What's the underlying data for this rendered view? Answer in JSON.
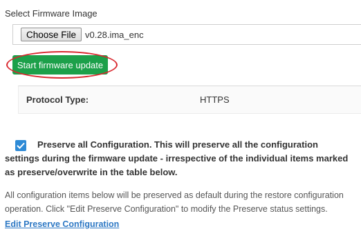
{
  "firmware": {
    "section_label": "Select Firmware Image",
    "choose_file_label": "Choose File",
    "file_name": "v0.28.ima_enc",
    "start_button_label": "Start firmware update"
  },
  "protocol": {
    "label": "Protocol Type:",
    "value": "HTTPS"
  },
  "preserve": {
    "checked": true,
    "text": "Preserve all Configuration. This will preserve all the configuration settings during the firmware update - irrespective of the individual items marked as preserve/overwrite in the table below."
  },
  "info_text": "All configuration items below will be preserved as default during the restore configuration operation. Click \"Edit Preserve Configuration\" to modify the Preserve status settings.",
  "edit_link_label": "Edit Preserve Configuration",
  "colors": {
    "start_button": "#1ca04a",
    "highlight": "#d9272e",
    "checkbox": "#2d8ad6",
    "link": "#2d78c4"
  }
}
